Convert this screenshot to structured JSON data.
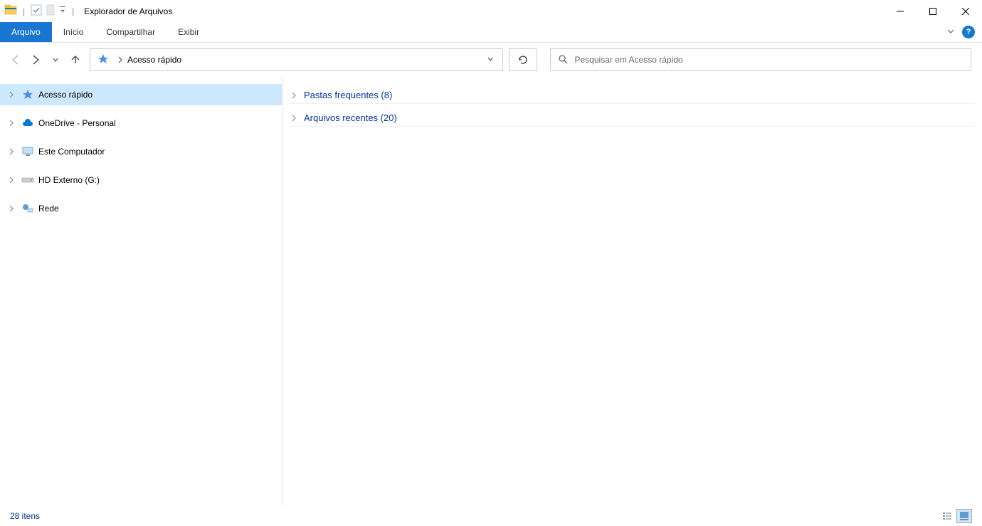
{
  "titlebar": {
    "app_title": "Explorador de Arquivos"
  },
  "ribbon": {
    "file": "Arquivo",
    "tabs": [
      "Início",
      "Compartilhar",
      "Exibir"
    ]
  },
  "addressbar": {
    "crumb": "Acesso rápido"
  },
  "search": {
    "placeholder": "Pesquisar em Acesso rápido"
  },
  "sidebar": {
    "items": [
      {
        "label": "Acesso rápido",
        "icon": "star",
        "selected": true
      },
      {
        "label": "OneDrive - Personal",
        "icon": "cloud",
        "selected": false
      },
      {
        "label": "Este Computador",
        "icon": "pc",
        "selected": false
      },
      {
        "label": "HD Externo (G:)",
        "icon": "drive",
        "selected": false
      },
      {
        "label": "Rede",
        "icon": "network",
        "selected": false
      }
    ]
  },
  "main": {
    "groups": [
      {
        "label": "Pastas frequentes (8)"
      },
      {
        "label": "Arquivos recentes (20)"
      }
    ]
  },
  "statusbar": {
    "items_text": "28 itens"
  }
}
